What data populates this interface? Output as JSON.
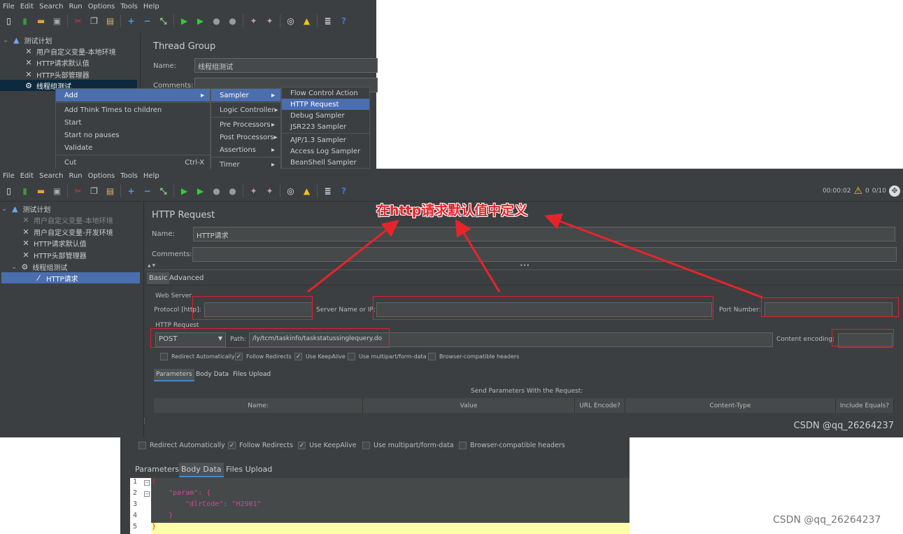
{
  "menubar": [
    "File",
    "Edit",
    "Search",
    "Run",
    "Options",
    "Tools",
    "Help"
  ],
  "toolbar_icons": [
    "new-icon",
    "templates-icon",
    "open-icon",
    "save-icon",
    "cut-icon",
    "copy-icon",
    "paste-icon",
    "expand-icon",
    "collapse-icon",
    "toggle-icon",
    "start-icon",
    "start-no-pauses-icon",
    "stop-icon",
    "shutdown-icon",
    "clear-icon",
    "clear-all-icon",
    "search-icon",
    "reset-search-icon",
    "function-helper-icon",
    "help-icon"
  ],
  "top": {
    "tree": [
      "测试计划",
      "用户自定义变量-本地环境",
      "HTTP请求默认值",
      "HTTP头部管理器",
      "线程组测试"
    ],
    "panel_title": "Thread Group",
    "name_label": "Name:",
    "name_value": "线程组测试",
    "comments_label": "Comments:",
    "context_menu": {
      "items": [
        "Add",
        "Add Think Times to children",
        "Start",
        "Start no pauses",
        "Validate",
        "Cut"
      ],
      "cut_shortcut": "Ctrl-X"
    },
    "add_submenu": [
      "Sampler",
      "Logic Controller",
      "Pre Processors",
      "Post Processors",
      "Assertions",
      "Timer"
    ],
    "sampler_submenu": [
      "Flow Control Action",
      "HTTP Request",
      "Debug Sampler",
      "JSR223 Sampler",
      "AJP/1.3 Sampler",
      "Access Log Sampler",
      "BeanShell Sampler"
    ]
  },
  "main": {
    "status": {
      "timer": "00:00:02",
      "warnings": "0",
      "threads": "0/10"
    },
    "tree": [
      "测试计划",
      "用户自定义变量-本地环境",
      "用户自定义变量-开发环境",
      "HTTP请求默认值",
      "HTTP头部管理器",
      "线程组测试",
      "HTTP请求"
    ],
    "panel_title": "HTTP Request",
    "name_label": "Name:",
    "name_value": "HTTP请求",
    "comments_label": "Comments:",
    "tabs": [
      "Basic",
      "Advanced"
    ],
    "web_server": "Web Server",
    "protocol_label": "Protocol [http]:",
    "server_label": "Server Name or IP:",
    "port_label": "Port Number:",
    "http_request": "HTTP Request",
    "method": "POST",
    "path_label": "Path:",
    "path_value": "/ly/tcm/taskinfo/taskstatussinglequery.do",
    "encoding_label": "Content encoding:",
    "checkboxes": [
      {
        "label": "Redirect Automatically",
        "checked": false
      },
      {
        "label": "Follow Redirects",
        "checked": true
      },
      {
        "label": "Use KeepAlive",
        "checked": true
      },
      {
        "label": "Use multipart/form-data",
        "checked": false
      },
      {
        "label": "Browser-compatible headers",
        "checked": false
      }
    ],
    "subtabs": [
      "Parameters",
      "Body Data",
      "Files Upload"
    ],
    "send_params": "Send Parameters With the Request:",
    "columns": [
      "Name:",
      "Value",
      "URL Encode?",
      "Content-Type",
      "Include Equals?"
    ],
    "annotation": "在http请求默认值中定义",
    "watermark": "CSDN @qq_26264237"
  },
  "bottom": {
    "checkboxes": [
      {
        "label": "Redirect Automatically",
        "checked": false
      },
      {
        "label": "Follow Redirects",
        "checked": true
      },
      {
        "label": "Use KeepAlive",
        "checked": true
      },
      {
        "label": "Use multipart/form-data",
        "checked": false
      },
      {
        "label": "Browser-compatible headers",
        "checked": false
      }
    ],
    "subtabs": [
      "Parameters",
      "Body Data",
      "Files Upload"
    ],
    "code_lines": [
      {
        "n": "1",
        "text": "{"
      },
      {
        "n": "2",
        "text": "    \"param\": {"
      },
      {
        "n": "3",
        "text": "        \"dlrCode\": \"H2901\""
      },
      {
        "n": "4",
        "text": "    }"
      },
      {
        "n": "5",
        "text": "}"
      }
    ],
    "watermark": "CSDN @qq_26264237"
  },
  "colors": {
    "annotation": "#e8242b",
    "selection": "#4b6eaf",
    "background": "#3c3f41"
  }
}
